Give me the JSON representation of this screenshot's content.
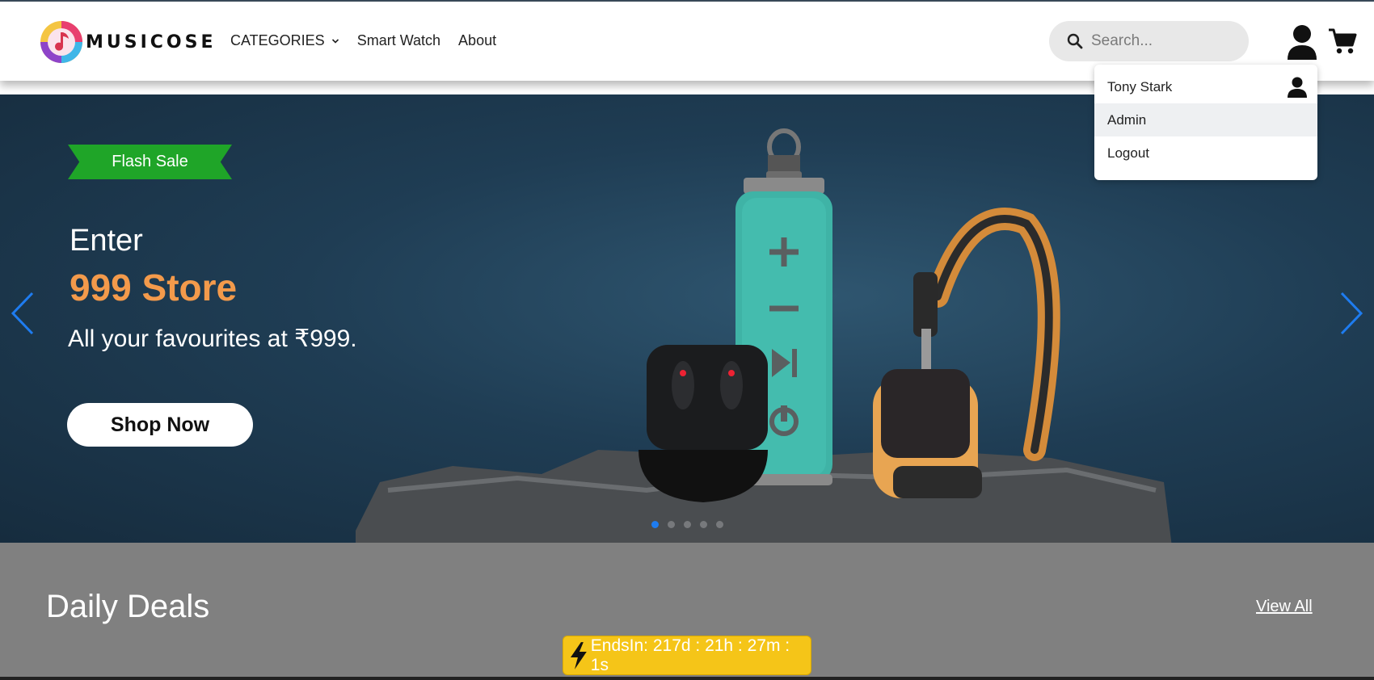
{
  "header": {
    "brand": "MUSICOSE",
    "nav": {
      "categories": "CATEGORIES",
      "smart_watch": "Smart Watch",
      "about": "About"
    },
    "search": {
      "placeholder": "Search..."
    },
    "icons": [
      "search-icon",
      "user-icon",
      "cart-icon",
      "chevron-down-icon"
    ]
  },
  "user_menu": {
    "name": "Tony Stark",
    "items": [
      "Admin",
      "Logout"
    ]
  },
  "hero": {
    "badge": "Flash Sale",
    "line1": "Enter",
    "line2": "999 Store",
    "line3": "All your favourites at ₹999.",
    "cta": "Shop Now",
    "slides_total": 5,
    "active_slide": 1
  },
  "deals": {
    "title": "Daily Deals",
    "view_all": "View All",
    "timer": "EndsIn: 217d : 21h : 27m : 1s"
  },
  "colors": {
    "flash_badge": "#1fa528",
    "store_text": "#f39a4b",
    "timer_bg": "#f5c518",
    "deals_bg": "#808080",
    "carousel_arrow": "#1e7cf0"
  }
}
